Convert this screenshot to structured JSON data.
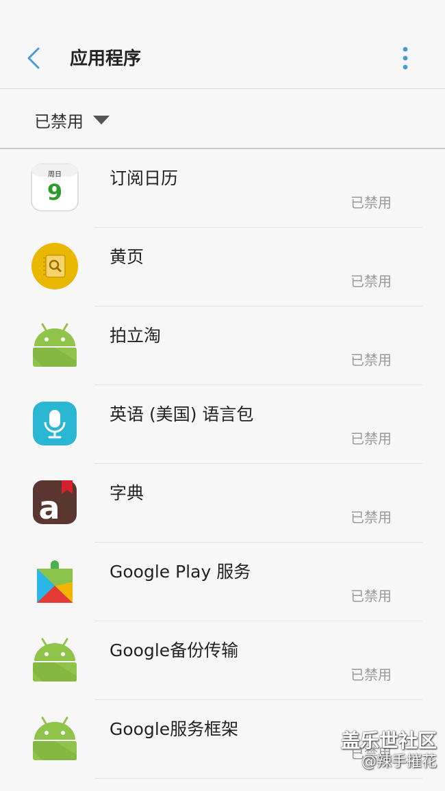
{
  "header": {
    "title": "应用程序",
    "back_icon": "chevron-left-icon",
    "more_icon": "more-vertical-icon",
    "accent_color": "#4a9ad4"
  },
  "filter": {
    "label": "已禁用",
    "caret_icon": "caret-down-icon"
  },
  "apps": [
    {
      "name": "订阅日历",
      "status": "已禁用",
      "icon": "calendar-icon",
      "icon_text_top": "周日",
      "icon_text_day": "9"
    },
    {
      "name": "黄页",
      "status": "已禁用",
      "icon": "yellow-pages-icon"
    },
    {
      "name": "拍立淘",
      "status": "已禁用",
      "icon": "android-icon"
    },
    {
      "name": "英语 (美国) 语言包",
      "status": "已禁用",
      "icon": "microphone-icon"
    },
    {
      "name": "字典",
      "status": "已禁用",
      "icon": "dictionary-icon",
      "icon_letter": "a"
    },
    {
      "name": "Google Play 服务",
      "status": "已禁用",
      "icon": "google-play-services-icon"
    },
    {
      "name": "Google备份传输",
      "status": "已禁用",
      "icon": "android-icon"
    },
    {
      "name": "Google服务框架",
      "status": "已禁用",
      "icon": "android-icon"
    }
  ],
  "watermark": {
    "line1": "盖乐世社区",
    "line2": "@辣手摧花"
  }
}
